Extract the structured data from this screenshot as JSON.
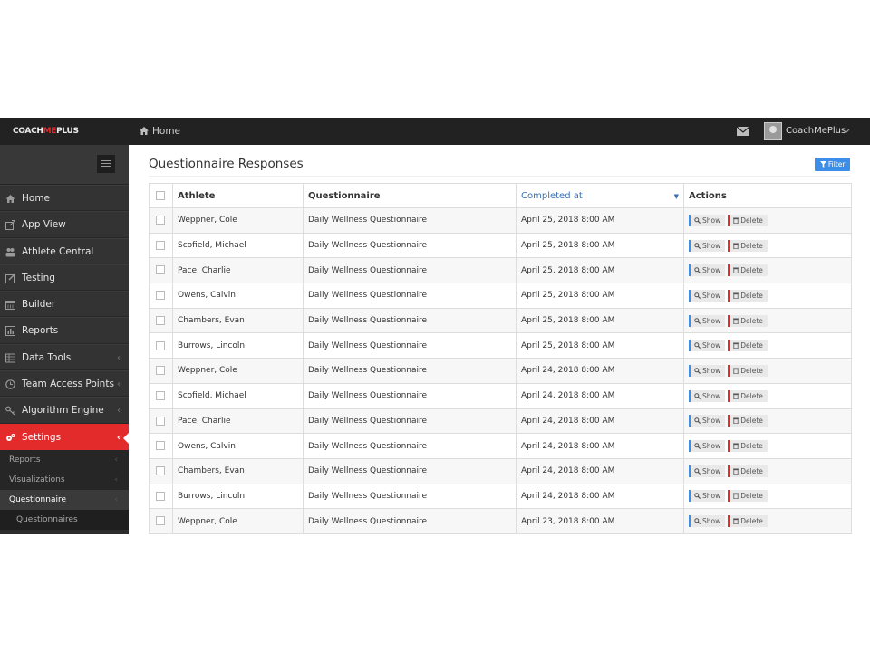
{
  "brand": {
    "part1": "COACH",
    "part2": "ME",
    "part3": "PLUS"
  },
  "header": {
    "breadcrumb": "Home",
    "user": "CoachMePlus"
  },
  "sidebar": {
    "items": [
      {
        "label": "Home",
        "icon": "home-icon"
      },
      {
        "label": "App View",
        "icon": "external-link-icon"
      },
      {
        "label": "Athlete Central",
        "icon": "users-icon"
      },
      {
        "label": "Testing",
        "icon": "edit-icon"
      },
      {
        "label": "Builder",
        "icon": "calendar-icon"
      },
      {
        "label": "Reports",
        "icon": "bar-chart-icon"
      },
      {
        "label": "Data Tools",
        "icon": "table-icon"
      },
      {
        "label": "Team Access Points",
        "icon": "clock-icon"
      },
      {
        "label": "Algorithm Engine",
        "icon": "key-icon"
      },
      {
        "label": "Settings",
        "icon": "cogs-icon"
      }
    ],
    "sub_items": [
      "Reports",
      "Visualizations",
      "Questionnaire",
      "Questionnaires"
    ]
  },
  "main": {
    "title": "Questionnaire Responses",
    "filter_label": "Filter",
    "columns": [
      "Athlete",
      "Questionnaire",
      "Completed at",
      "Actions"
    ],
    "show_label": "Show",
    "delete_label": "Delete",
    "rows": [
      {
        "athlete": "Weppner, Cole",
        "questionnaire": "Daily Wellness Questionnaire",
        "completed": "April 25, 2018 8:00 AM"
      },
      {
        "athlete": "Scofield, Michael",
        "questionnaire": "Daily Wellness Questionnaire",
        "completed": "April 25, 2018 8:00 AM"
      },
      {
        "athlete": "Pace, Charlie",
        "questionnaire": "Daily Wellness Questionnaire",
        "completed": "April 25, 2018 8:00 AM"
      },
      {
        "athlete": "Owens, Calvin",
        "questionnaire": "Daily Wellness Questionnaire",
        "completed": "April 25, 2018 8:00 AM"
      },
      {
        "athlete": "Chambers, Evan",
        "questionnaire": "Daily Wellness Questionnaire",
        "completed": "April 25, 2018 8:00 AM"
      },
      {
        "athlete": "Burrows, Lincoln",
        "questionnaire": "Daily Wellness Questionnaire",
        "completed": "April 25, 2018 8:00 AM"
      },
      {
        "athlete": "Weppner, Cole",
        "questionnaire": "Daily Wellness Questionnaire",
        "completed": "April 24, 2018 8:00 AM"
      },
      {
        "athlete": "Scofield, Michael",
        "questionnaire": "Daily Wellness Questionnaire",
        "completed": "April 24, 2018 8:00 AM"
      },
      {
        "athlete": "Pace, Charlie",
        "questionnaire": "Daily Wellness Questionnaire",
        "completed": "April 24, 2018 8:00 AM"
      },
      {
        "athlete": "Owens, Calvin",
        "questionnaire": "Daily Wellness Questionnaire",
        "completed": "April 24, 2018 8:00 AM"
      },
      {
        "athlete": "Chambers, Evan",
        "questionnaire": "Daily Wellness Questionnaire",
        "completed": "April 24, 2018 8:00 AM"
      },
      {
        "athlete": "Burrows, Lincoln",
        "questionnaire": "Daily Wellness Questionnaire",
        "completed": "April 24, 2018 8:00 AM"
      },
      {
        "athlete": "Weppner, Cole",
        "questionnaire": "Daily Wellness Questionnaire",
        "completed": "April 23, 2018 8:00 AM"
      }
    ]
  },
  "colors": {
    "accent": "#e32b2b",
    "primary": "#3c8ee8",
    "topbar": "#222222",
    "sidebar": "#2c2c2c"
  }
}
